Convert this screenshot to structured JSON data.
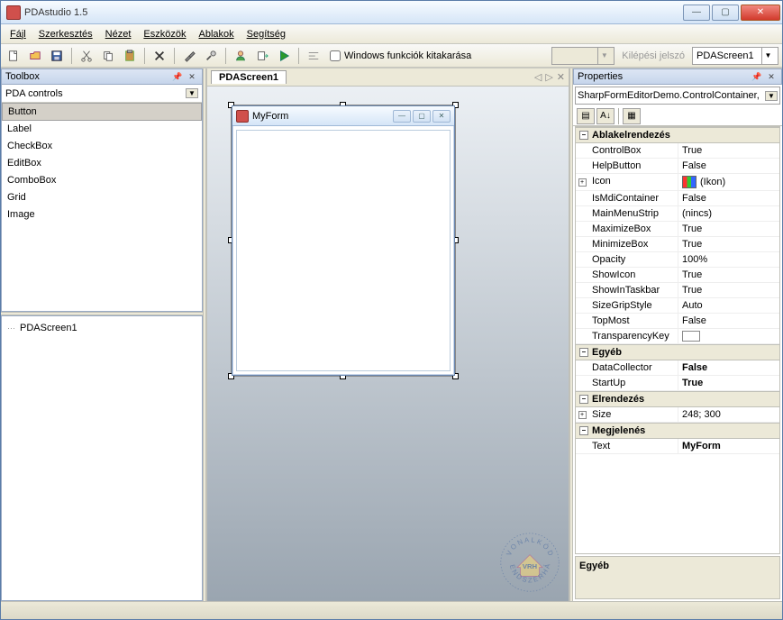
{
  "window": {
    "title": "PDAstudio 1.5"
  },
  "menu": {
    "items": [
      "Fájl",
      "Szerkesztés",
      "Nézet",
      "Eszközök",
      "Ablakok",
      "Segítség"
    ]
  },
  "toolbar": {
    "checkbox_label": "Windows funkciók kitakarása",
    "label_disabled": "Kilépési jelszó",
    "screen_combo": "PDAScreen1"
  },
  "toolbox": {
    "header": "Toolbox",
    "combo": "PDA controls",
    "items": [
      "Button",
      "Label",
      "CheckBox",
      "EditBox",
      "ComboBox",
      "Grid",
      "Image"
    ],
    "selected_index": 0
  },
  "tree": {
    "items": [
      "PDAScreen1"
    ]
  },
  "document": {
    "tab": "PDAScreen1",
    "form_title": "MyForm"
  },
  "properties": {
    "header": "Properties",
    "object_combo": "SharpFormEditorDemo.ControlContainer,",
    "categories": [
      {
        "name": "Ablakelrendezés",
        "expanded": true,
        "rows": [
          {
            "name": "ControlBox",
            "value": "True"
          },
          {
            "name": "HelpButton",
            "value": "False"
          },
          {
            "name": "Icon",
            "value": "(Ikon)",
            "icon": true,
            "expandable": true
          },
          {
            "name": "IsMdiContainer",
            "value": "False"
          },
          {
            "name": "MainMenuStrip",
            "value": "(nincs)"
          },
          {
            "name": "MaximizeBox",
            "value": "True"
          },
          {
            "name": "MinimizeBox",
            "value": "True"
          },
          {
            "name": "Opacity",
            "value": "100%"
          },
          {
            "name": "ShowIcon",
            "value": "True"
          },
          {
            "name": "ShowInTaskbar",
            "value": "True"
          },
          {
            "name": "SizeGripStyle",
            "value": "Auto"
          },
          {
            "name": "TopMost",
            "value": "False"
          },
          {
            "name": "TransparencyKey",
            "value": "",
            "swatch": true
          }
        ]
      },
      {
        "name": "Egyéb",
        "expanded": true,
        "rows": [
          {
            "name": "DataCollector",
            "value": "False",
            "bold": true
          },
          {
            "name": "StartUp",
            "value": "True",
            "bold": true
          }
        ]
      },
      {
        "name": "Elrendezés",
        "expanded": true,
        "rows": [
          {
            "name": "Size",
            "value": "248; 300",
            "expandable": true
          }
        ]
      },
      {
        "name": "Megjelenés",
        "expanded": true,
        "rows": [
          {
            "name": "Text",
            "value": "MyForm",
            "bold": true
          }
        ]
      }
    ],
    "description_header": "Egyéb"
  },
  "logo": {
    "top": "V O N A L K Ó D",
    "mid": "VRH",
    "bottom": "R E N D S Z E R H Á Z"
  }
}
